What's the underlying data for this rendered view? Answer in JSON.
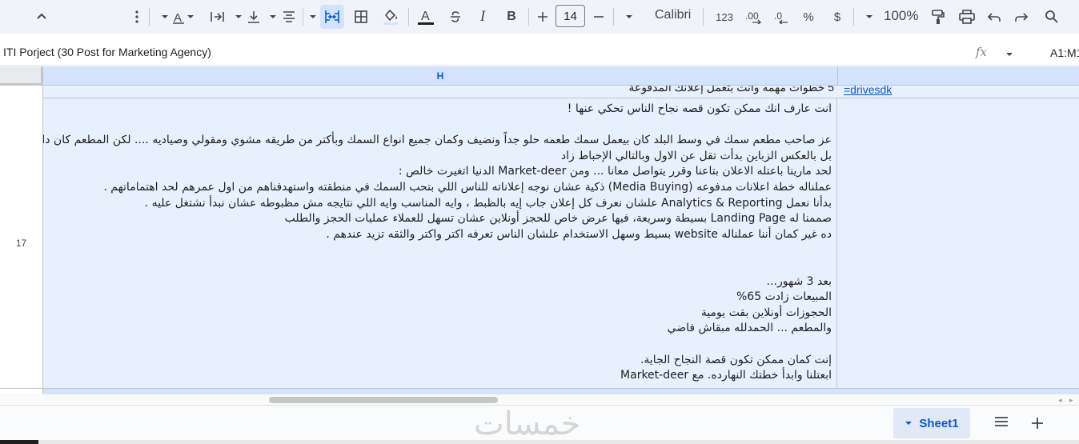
{
  "toolbar": {
    "font_size": "14",
    "font_name": "Calibri",
    "number_format_label": "123",
    "percent_label": "%",
    "currency_label": "$",
    "zoom": "100%",
    "bold_label": "B",
    "italic_label": "I"
  },
  "formula_bar": {
    "content": "ITI Porject (30 Post for Marketing Agency)",
    "fx_label": "fx",
    "name_box": "A1:M1"
  },
  "grid": {
    "column_h_label": "H",
    "row16_h_text": "5 خطوات مهمه وانت بتعمل إعلانك المدفوعة",
    "row16_i_text": "=drivesdk",
    "row17_number": "17",
    "row17_h_lines": [
      "انت عارف انك ممكن تكون قصه نجاح الناس تحكي عنها !",
      "",
      "عز صاحب مطعم سمك في وسط البلد كان بيعمل سمك طعمه حلو جداً ونضيف وكمان جميع انواع السمك وبأكتر من طريقه مشوي ومقولي وصياديه .... لكن المطعم كان دايما فاضي أغلب ا",
      "بل بالعكس الزباين بدأت تقل عن الاول وبالتالي الإحباط زاد",
      "لحد مارينا باعتله الاعلان بتاعنا وقرر يتواصل معانا ... ومن Market-deer الدنيا اتغيرت خالص :",
      "عملناله خطة اعلانات مدفوعه (Media Buying) ذكية عشان نوجه إعلاناته للناس اللي بتحب السمك في منطقته واستهدفناهم من اول عمرهم لحد اهتماماتهم .",
      "بدأنا نعمل Analytics & Reporting علشان نعرف كل إعلان جاب إيه بالظبط ، وايه المناسب وايه اللي نتايجه مش مظبوطه عشان نبدأ نشتغل عليه .",
      "صممنا له Landing Page بسيطة وسريعة، فيها عرض خاص للحجز أونلاين عشان تسهل للعملاء عمليات الحجز والطلب",
      "ده غير كمان أننا عملناله website بسيط وسهل الاستخدام علشان الناس تعرفه اكتر واكتر والثقه تزيد عندهم .",
      "",
      "",
      "بعد 3 شهور...",
      "المبيعات زادت 65%",
      "الحجوزات أونلاين بقت يومية",
      "والمطعم ... الحمدلله مبقاش فاضي",
      "",
      "إنت كمان ممكن تكون قصة النجاح الجاية.",
      "ابعتلنا وابدأ خطتك النهارده. مع Market-deer"
    ]
  },
  "sheets": {
    "active_tab": "Sheet1"
  },
  "watermark": "خمسات",
  "colors": {
    "accent": "#0b57d0",
    "selection": "#d3e3fd",
    "selected_cell_bg": "#e8f0fe",
    "toolbar_bg": "#f0f4f9"
  }
}
